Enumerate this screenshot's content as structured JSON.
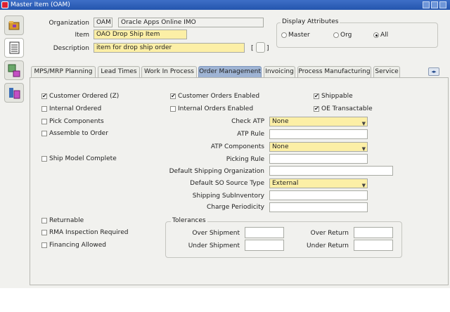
{
  "window": {
    "title": "Master Item (OAM)"
  },
  "header": {
    "organization_label": "Organization",
    "organization_code": "OAM",
    "organization_name": "Oracle Apps Online IMO",
    "item_label": "Item",
    "item_value": "OAO Drop Ship Item",
    "description_label": "Description",
    "description_value": "item for drop ship order",
    "dff_bracket": "[",
    "dff_bracket_close": "]"
  },
  "display_attributes": {
    "title": "Display Attributes",
    "options": [
      "Master",
      "Org",
      "All"
    ],
    "selected": "All"
  },
  "tabs": [
    "MPS/MRP Planning",
    "Lead Times",
    "Work In Process",
    "Order Management",
    "Invoicing",
    "Process Manufacturing",
    "Service"
  ],
  "active_tab": "Order Management",
  "order_management": {
    "customer_ordered": {
      "label": "Customer Ordered (Z)",
      "checked": true
    },
    "internal_ordered": {
      "label": "Internal Ordered",
      "checked": false
    },
    "pick_components": {
      "label": "Pick Components",
      "checked": false
    },
    "assemble_to_order": {
      "label": "Assemble to Order",
      "checked": false
    },
    "ship_model_complete": {
      "label": "Ship Model Complete",
      "checked": false
    },
    "customer_orders_enabled": {
      "label": "Customer Orders Enabled",
      "checked": true
    },
    "internal_orders_enabled": {
      "label": "Internal Orders Enabled",
      "checked": false
    },
    "shippable": {
      "label": "Shippable",
      "checked": true
    },
    "oe_transactable": {
      "label": "OE Transactable",
      "checked": true
    },
    "check_atp": {
      "label": "Check ATP",
      "value": "None"
    },
    "atp_rule": {
      "label": "ATP Rule",
      "value": ""
    },
    "atp_components": {
      "label": "ATP Components",
      "value": "None"
    },
    "picking_rule": {
      "label": "Picking Rule",
      "value": ""
    },
    "default_shipping_org": {
      "label": "Default Shipping Organization",
      "value": ""
    },
    "default_so_source_type": {
      "label": "Default SO Source Type",
      "value": "External"
    },
    "shipping_subinventory": {
      "label": "Shipping SubInventory",
      "value": ""
    },
    "charge_periodicity": {
      "label": "Charge Periodicity",
      "value": ""
    },
    "returnable": {
      "label": "Returnable",
      "checked": false
    },
    "rma_inspection_required": {
      "label": "RMA Inspection Required",
      "checked": false
    },
    "financing_allowed": {
      "label": "Financing Allowed",
      "checked": false
    },
    "tolerances": {
      "title": "Tolerances",
      "over_shipment": {
        "label": "Over Shipment",
        "value": ""
      },
      "under_shipment": {
        "label": "Under Shipment",
        "value": ""
      },
      "over_return": {
        "label": "Over Return",
        "value": ""
      },
      "under_return": {
        "label": "Under Return",
        "value": ""
      }
    }
  },
  "icons": {
    "window": "oracle-window-icon",
    "side_tabs": [
      "folder-icon",
      "list-icon",
      "item-cube-icon",
      "attributes-icon"
    ],
    "tab_scroll": "tab-scroll-icon"
  },
  "colors": {
    "required": "#fcefa6",
    "titlebar": "#2f61ba",
    "active_tab": "#9fb4d4"
  }
}
